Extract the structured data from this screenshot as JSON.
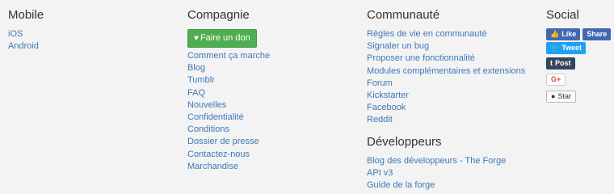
{
  "mobile": {
    "title": "Mobile",
    "links": [
      "iOS",
      "Android"
    ]
  },
  "company": {
    "title": "Compagnie",
    "donate_label": "Faire un don",
    "links": [
      "Comment ça marche",
      "Blog",
      "Tumblr",
      "FAQ",
      "Nouvelles",
      "Confidentialité",
      "Conditions",
      "Dossier de presse",
      "Contactez-nous",
      "Marchandise"
    ]
  },
  "community": {
    "title": "Communauté",
    "links": [
      "Règles de vie en communauté",
      "Signaler un bug",
      "Proposer une fonctionnalité",
      "Modules complémentaires et extensions",
      "Forum",
      "Kickstarter",
      "Facebook",
      "Reddit"
    ]
  },
  "developers": {
    "title": "Développeurs",
    "links": [
      "Blog des développeurs - The Forge",
      "API v3",
      "Guide de la forge"
    ]
  },
  "social": {
    "title": "Social",
    "like_label": "Like",
    "share_label": "Share",
    "tweet_label": "Tweet",
    "post_label": "Post",
    "gplus_label": "G+",
    "star_label": "Star"
  },
  "colors": {
    "link": "#3d78b8",
    "donate": "#4fae52",
    "facebook": "#4267b2",
    "twitter": "#1da1f2",
    "tumblr": "#35465c"
  }
}
